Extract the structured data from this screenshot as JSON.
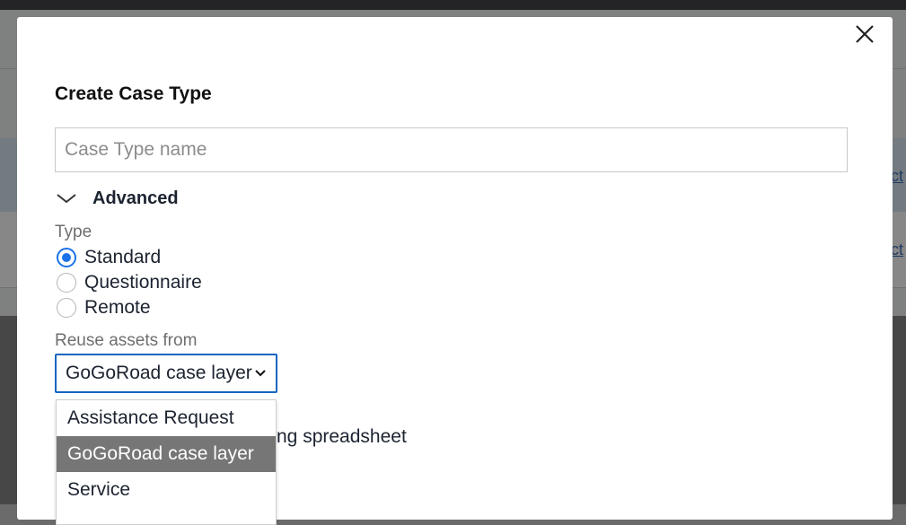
{
  "background": {
    "links": [
      "ct",
      "ct"
    ]
  },
  "modal": {
    "title": "Create Case Type",
    "case_type_input": {
      "value": "",
      "placeholder": "Case Type name"
    },
    "advanced": {
      "label": "Advanced",
      "icon": "chevron-down-icon",
      "expanded": true
    },
    "type": {
      "label": "Type",
      "options": [
        "Standard",
        "Questionnaire",
        "Remote"
      ],
      "selected": "Standard"
    },
    "reuse": {
      "label": "Reuse assets from",
      "selected": "GoGoRoad case layer",
      "options": [
        "Assistance Request",
        "GoGoRoad case layer",
        "Service"
      ]
    },
    "partially_hidden_text": "ng spreadsheet",
    "accent_color": "#1a73e8"
  }
}
